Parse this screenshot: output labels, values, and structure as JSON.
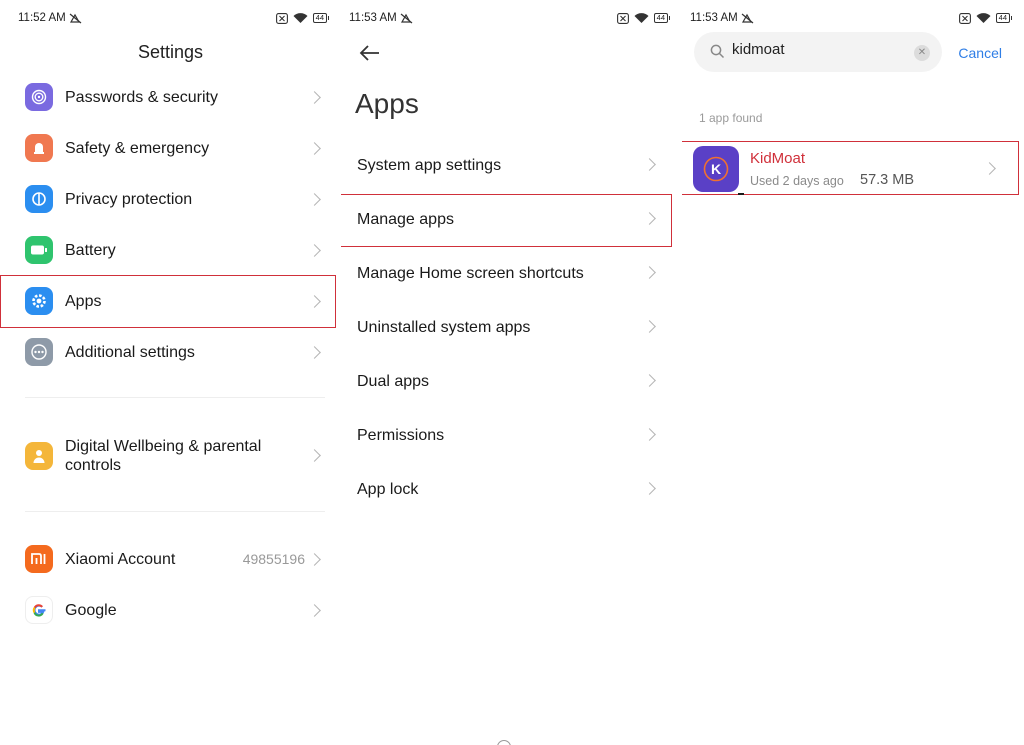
{
  "panel1": {
    "status": {
      "time": "11:52 AM",
      "battery": "44"
    },
    "title": "Settings",
    "items": [
      {
        "label": "Passwords & security",
        "icon": "fingerprint-icon",
        "color": "#7a6ae0"
      },
      {
        "label": "Safety & emergency",
        "icon": "safety-icon",
        "color": "#f07850"
      },
      {
        "label": "Privacy protection",
        "icon": "privacy-icon",
        "color": "#2b8ef0"
      },
      {
        "label": "Battery",
        "icon": "battery-icon",
        "color": "#2fc46e"
      },
      {
        "label": "Apps",
        "icon": "gear-icon",
        "color": "#2b8ef0"
      },
      {
        "label": "Additional settings",
        "icon": "more-icon",
        "color": "#8e9aa8"
      },
      {
        "label": "Digital Wellbeing & parental controls",
        "icon": "wellbeing-icon",
        "color": "#f4b63a"
      },
      {
        "label": "Xiaomi Account",
        "value": "49855196",
        "icon": "mi-icon",
        "color": "#f46a1e"
      },
      {
        "label": "Google",
        "icon": "google-icon",
        "color": "#ffffff"
      }
    ]
  },
  "panel2": {
    "status": {
      "time": "11:53 AM",
      "battery": "44"
    },
    "title": "Apps",
    "items": [
      {
        "label": "System app settings"
      },
      {
        "label": "Manage apps"
      },
      {
        "label": "Manage Home screen shortcuts"
      },
      {
        "label": "Uninstalled system apps"
      },
      {
        "label": "Dual apps"
      },
      {
        "label": "Permissions"
      },
      {
        "label": "App lock"
      }
    ]
  },
  "panel3": {
    "status": {
      "time": "11:53 AM",
      "battery": "44"
    },
    "search": {
      "value": "kidmoat",
      "cancel_label": "Cancel"
    },
    "found_text": "1 app found",
    "result": {
      "name": "KidMoat",
      "icon_letter": "K",
      "used": "Used 2 days ago",
      "size": "57.3 MB"
    }
  },
  "colors": {
    "highlight": "#d0303a",
    "accent": "#2f7ee6"
  }
}
